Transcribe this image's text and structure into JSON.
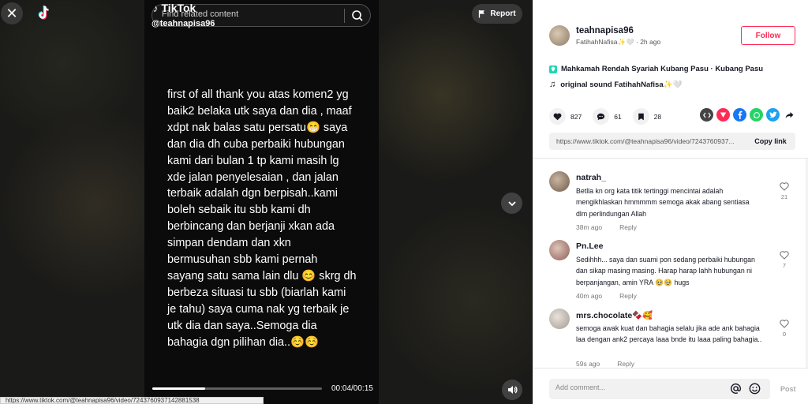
{
  "player": {
    "brand": "TikTok",
    "handle": "@teahnapisa96",
    "search_placeholder": "Find related content",
    "report_label": "Report",
    "caption_text": "first of all thank you atas komen2 yg baik2 belaka utk saya dan dia , maaf xdpt nak balas satu persatu😁 saya dan dia dh cuba perbaiki hubungan kami dari bulan 1 tp kami masih lg xde jalan penyelesaian , dan jalan terbaik adalah dgn berpisah..kami boleh sebaik itu sbb kami dh berbincang dan berjanji xkan ada simpan dendam dan xkn bermusuhan sbb kami pernah sayang satu sama lain dlu 😊 skrg dh berbeza situasi tu sbb (biarlah kami je tahu) saya cuma nak yg terbaik je utk dia dan saya..Semoga dia bahagia dgn pilihan dia..☺️☺️",
    "time": "00:04/00:15",
    "progress": 0.31,
    "status_url": "https://www.tiktok.com/@teahnapisa96/video/7243760937142881538"
  },
  "post": {
    "author_name": "teahnapisa96",
    "author_display": "FatihahNafisa✨🤍",
    "age": "2h ago",
    "follow_label": "Follow",
    "location": "Mahkamah Rendah Syariah Kubang Pasu · Kubang Pasu",
    "sound": "original sound FatihahNafisa✨🤍",
    "likes": "827",
    "comments": "61",
    "saves": "28",
    "link": "https://www.tiktok.com/@teahnapisa96/video/7243760937...",
    "copy_label": "Copy link"
  },
  "comments": [
    {
      "user": "natrah_",
      "text": "Betlla kn org kata titik tertinggi mencintai adalah mengikhlaskan hmmmmm semoga akak abang sentiasa dlm perlindungan Allah",
      "age": "38m ago",
      "reply": "Reply",
      "likes": "21"
    },
    {
      "user": "Pn.Lee",
      "text": "Sedihhh... saya dan suami pon sedang perbaiki hubungan dan sikap masing masing. Harap harap lahh hubungan ni berpanjangan, amin YRA 🥹🥹 hugs",
      "age": "40m ago",
      "reply": "Reply",
      "likes": "7"
    },
    {
      "user": "mrs.chocolate🍫🥰",
      "text": "semoga awak kuat dan bahagia selalu jika ade ank bahagia laa dengan ank2 percaya laaa bnde itu laaa paling bahagia..",
      "age": "59s ago",
      "reply": "Reply",
      "likes": "0"
    }
  ],
  "composer": {
    "placeholder": "Add comment...",
    "post_label": "Post"
  },
  "colors": {
    "accent": "#fe2c55",
    "location_pin": "#20d5b3"
  },
  "icons": [
    "close-icon",
    "tiktok-logo-icon",
    "search-icon",
    "flag-icon",
    "chevron-down-icon",
    "volume-icon",
    "heart-icon",
    "comment-icon",
    "bookmark-icon",
    "embed-icon",
    "send-icon",
    "facebook-icon",
    "whatsapp-icon",
    "twitter-icon",
    "share-arrow-icon",
    "at-icon",
    "emoji-icon",
    "music-note-icon",
    "location-pin-icon"
  ]
}
